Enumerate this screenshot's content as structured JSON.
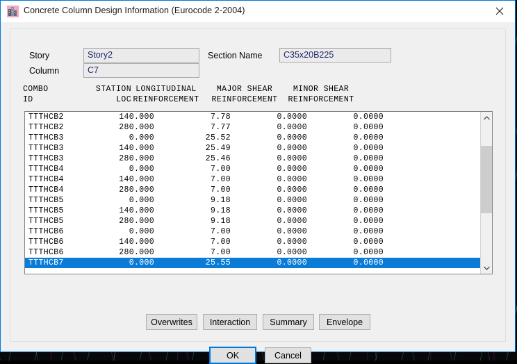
{
  "window": {
    "title": "Concrete Column Design Information (Eurocode 2-2004)",
    "icon": "etabs-building-icon",
    "close_label": "close-icon",
    "accent_color": "#0078d7",
    "selection_color": "#0a7bd6"
  },
  "fields": {
    "story_label": "Story",
    "story_value": "Story2",
    "column_label": "Column",
    "column_value": "C7",
    "section_name_label": "Section Name",
    "section_name_value": "C35x20B225"
  },
  "table": {
    "headers_line1": [
      "COMBO",
      "STATION",
      "LONGITUDINAL",
      "MAJOR SHEAR",
      "MINOR SHEAR"
    ],
    "headers_line2": [
      "ID",
      "LOC",
      "REINFORCEMENT",
      "REINFORCEMENT",
      "REINFORCEMENT"
    ],
    "rows": [
      {
        "combo": "TTTHCB2",
        "station": "140.000",
        "longitudinal": "7.78",
        "major": "0.0000",
        "minor": "0.0000",
        "selected": false
      },
      {
        "combo": "TTTHCB2",
        "station": "280.000",
        "longitudinal": "7.77",
        "major": "0.0000",
        "minor": "0.0000",
        "selected": false
      },
      {
        "combo": "TTTHCB3",
        "station": "0.000",
        "longitudinal": "25.52",
        "major": "0.0000",
        "minor": "0.0000",
        "selected": false
      },
      {
        "combo": "TTTHCB3",
        "station": "140.000",
        "longitudinal": "25.49",
        "major": "0.0000",
        "minor": "0.0000",
        "selected": false
      },
      {
        "combo": "TTTHCB3",
        "station": "280.000",
        "longitudinal": "25.46",
        "major": "0.0000",
        "minor": "0.0000",
        "selected": false
      },
      {
        "combo": "TTTHCB4",
        "station": "0.000",
        "longitudinal": "7.00",
        "major": "0.0000",
        "minor": "0.0000",
        "selected": false
      },
      {
        "combo": "TTTHCB4",
        "station": "140.000",
        "longitudinal": "7.00",
        "major": "0.0000",
        "minor": "0.0000",
        "selected": false
      },
      {
        "combo": "TTTHCB4",
        "station": "280.000",
        "longitudinal": "7.00",
        "major": "0.0000",
        "minor": "0.0000",
        "selected": false
      },
      {
        "combo": "TTTHCB5",
        "station": "0.000",
        "longitudinal": "9.18",
        "major": "0.0000",
        "minor": "0.0000",
        "selected": false
      },
      {
        "combo": "TTTHCB5",
        "station": "140.000",
        "longitudinal": "9.18",
        "major": "0.0000",
        "minor": "0.0000",
        "selected": false
      },
      {
        "combo": "TTTHCB5",
        "station": "280.000",
        "longitudinal": "9.18",
        "major": "0.0000",
        "minor": "0.0000",
        "selected": false
      },
      {
        "combo": "TTTHCB6",
        "station": "0.000",
        "longitudinal": "7.00",
        "major": "0.0000",
        "minor": "0.0000",
        "selected": false
      },
      {
        "combo": "TTTHCB6",
        "station": "140.000",
        "longitudinal": "7.00",
        "major": "0.0000",
        "minor": "0.0000",
        "selected": false
      },
      {
        "combo": "TTTHCB6",
        "station": "280.000",
        "longitudinal": "7.00",
        "major": "0.0000",
        "minor": "0.0000",
        "selected": false
      },
      {
        "combo": "TTTHCB7",
        "station": "0.000",
        "longitudinal": "25.55",
        "major": "0.0000",
        "minor": "0.0000",
        "selected": true
      }
    ]
  },
  "buttons": {
    "overwrites": "Overwrites",
    "interaction": "Interaction",
    "summary": "Summary",
    "envelope": "Envelope",
    "ok": "OK",
    "cancel": "Cancel"
  }
}
